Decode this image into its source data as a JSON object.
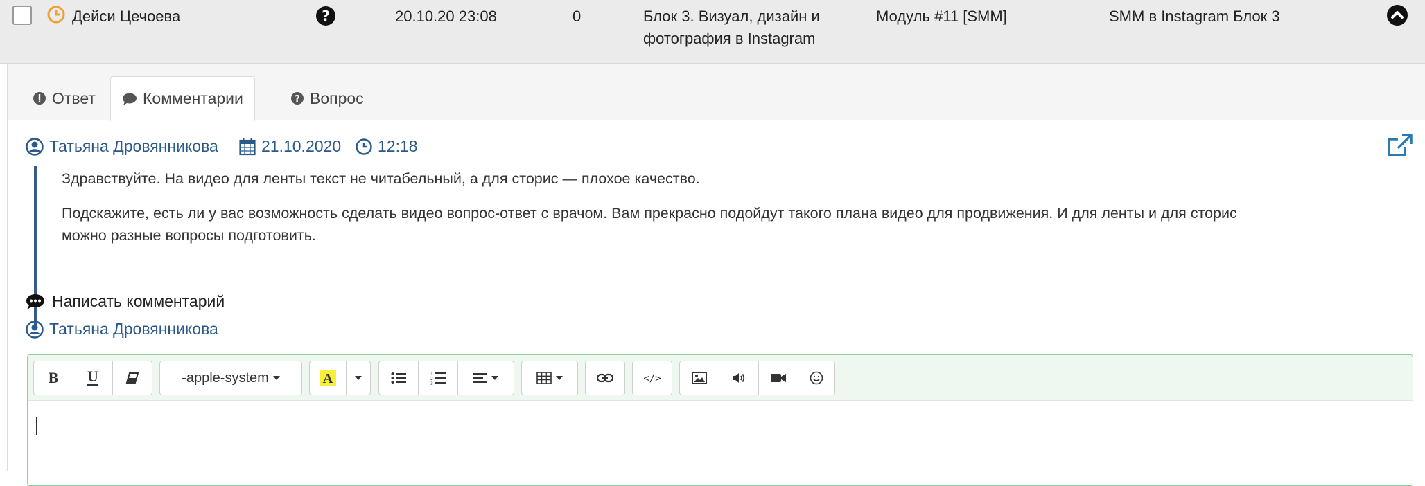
{
  "row": {
    "student": "Дейси Цечоева",
    "datetime": "20.10.20 23:08",
    "count": "0",
    "lesson_line1": "Блок 3. Визуал, дизайн и",
    "lesson_line2": "фотография в Instagram",
    "module": "Модуль #11 [SMM]",
    "course": "SMM в Instagram Блок 3"
  },
  "tabs": [
    {
      "label": "Ответ",
      "icon": "exclamation-circle-icon"
    },
    {
      "label": "Комментарии",
      "icon": "comment-icon",
      "active": true
    },
    {
      "label": "Вопрос",
      "icon": "question-circle-icon"
    }
  ],
  "comment": {
    "author": "Татьяна Дровянникова",
    "date": "21.10.2020",
    "time": "12:18",
    "p1": "Здравствуйте. На видео для ленты текст не читабельный, а для сторис — плохое качество.",
    "p2_line1": "Подскажите, есть ли у вас возможность сделать видео вопрос-ответ с врачом. Вам прекрасно подойдут такого плана видео для продвижения. И для ленты и для сторис",
    "p2_line2": "можно разные вопросы подготовить."
  },
  "compose": {
    "title": "Написать комментарий",
    "author": "Татьяна Дровянникова",
    "font_select": "-apple-system"
  },
  "colors": {
    "link": "#2a5a8c",
    "accent_orange": "#f0a030",
    "editor_border": "#8fcf9b",
    "toolbar_bg": "#eef8f0"
  }
}
